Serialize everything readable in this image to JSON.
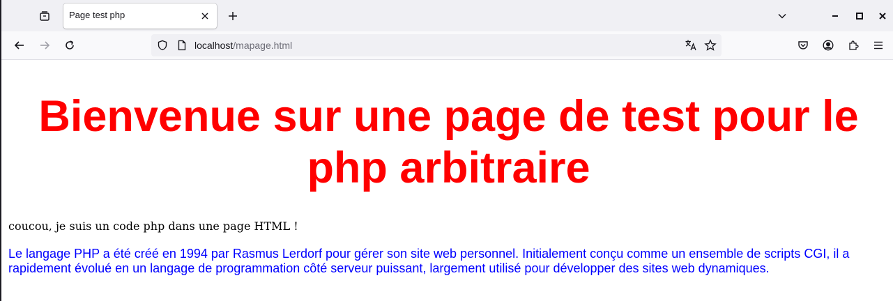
{
  "browser": {
    "tab": {
      "title": "Page test php"
    },
    "url": {
      "host": "localhost",
      "path": "/mapage.html"
    },
    "icons": {
      "tabs_list": "tabs-list-icon",
      "tab_close": "close-icon",
      "new_tab": "plus-icon",
      "all_tabs": "chevron-down-icon",
      "minimize": "minimize-icon",
      "maximize": "maximize-icon",
      "close": "close-icon",
      "back": "back-arrow-icon",
      "forward": "forward-arrow-icon",
      "reload": "reload-icon",
      "shield": "shield-icon",
      "page": "page-icon",
      "translate": "translate-icon",
      "bookmark": "star-icon",
      "pocket": "pocket-icon",
      "account": "account-icon",
      "extensions": "extensions-icon",
      "menu": "hamburger-menu-icon"
    }
  },
  "page": {
    "heading": "Bienvenue sur une page de test pour le php arbitraire",
    "greeting": "coucou, je suis un code php dans une page HTML !",
    "paragraph": "Le langage PHP a été créé en 1994 par Rasmus Lerdorf pour gérer son site web personnel. Initialement conçu comme un ensemble de scripts CGI, il a rapidement évolué en un langage de programmation côté serveur puissant, largement utilisé pour développer des sites web dynamiques."
  },
  "colors": {
    "heading": "#ff0000",
    "paragraph": "#0000ff",
    "greeting": "#000000"
  }
}
